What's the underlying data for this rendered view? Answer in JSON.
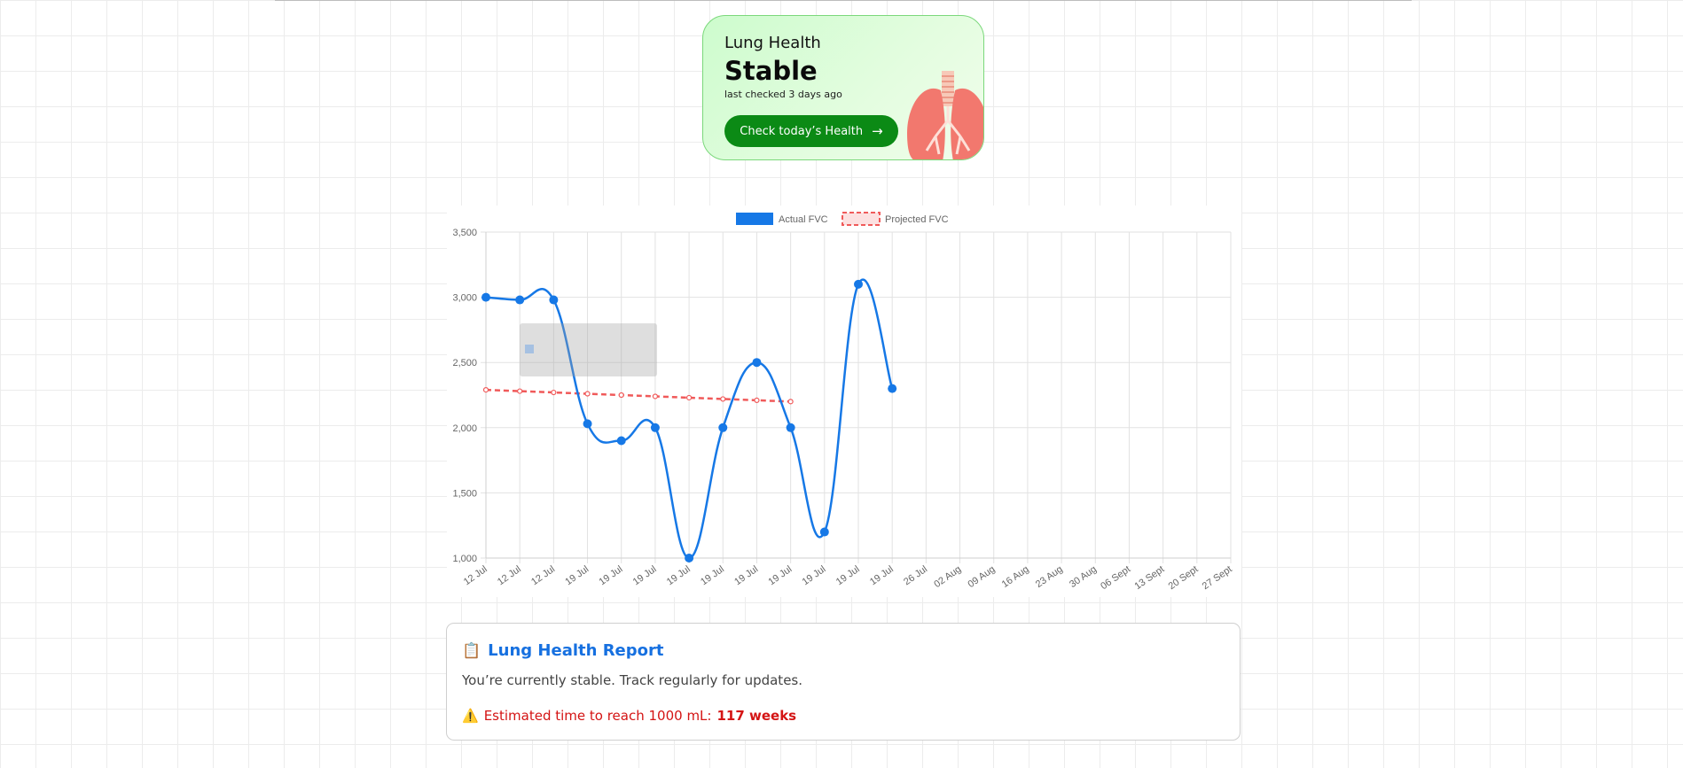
{
  "status_card": {
    "title": "Lung Health",
    "status": "Stable",
    "subtitle": "last checked 3 days ago",
    "button_label": "Check today’s Health",
    "colors": {
      "button": "#0b8a15",
      "border": "#7bd87b",
      "lungs": "#f2786e"
    }
  },
  "chart_data": {
    "type": "line",
    "categories": [
      "12 Jul",
      "12 Jul",
      "12 Jul",
      "19 Jul",
      "19 Jul",
      "19 Jul",
      "19 Jul",
      "19 Jul",
      "19 Jul",
      "19 Jul",
      "19 Jul",
      "19 Jul",
      "19 Jul",
      "26 Jul",
      "02 Aug",
      "09 Aug",
      "16 Aug",
      "23 Aug",
      "30 Aug",
      "06 Sept",
      "13 Sept",
      "20 Sept",
      "27 Sept"
    ],
    "yticks": [
      "1,000",
      "1,500",
      "2,000",
      "2,500",
      "3,000",
      "3,500"
    ],
    "ylim": [
      1000,
      3500
    ],
    "grid": true,
    "legend_position": "top",
    "series": [
      {
        "name": "Actual FVC",
        "color": "#1678e6",
        "style": "solid",
        "values": [
          3000,
          2980,
          2980,
          2030,
          1900,
          2000,
          1000,
          2000,
          2500,
          2000,
          1200,
          3100,
          2300
        ]
      },
      {
        "name": "Projected FVC",
        "color": "#f05a5a",
        "style": "dashed",
        "values": [
          2290,
          2280,
          2270,
          2260,
          2250,
          2240,
          2230,
          2220,
          2210,
          2200
        ]
      }
    ]
  },
  "report": {
    "icon": "clipboard-icon",
    "title": "Lung Health Report",
    "text": "You’re currently stable. Track regularly for updates.",
    "warning_prefix": "Estimated time to reach 1000 mL: ",
    "warning_value": "117 weeks",
    "warning_icon": "warning-icon"
  }
}
